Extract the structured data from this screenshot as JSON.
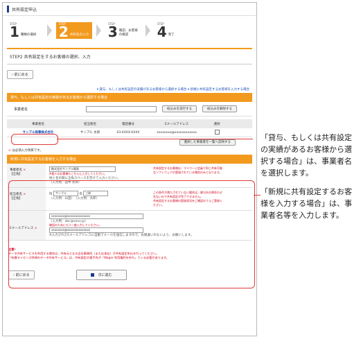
{
  "header": {
    "title": "共有設定申込"
  },
  "steps": [
    {
      "label": "STEP",
      "num": "1",
      "text": "種類の選択"
    },
    {
      "label": "STEP",
      "num": "2",
      "text": "共有先の入力"
    },
    {
      "label": "STEP",
      "num": "3",
      "text": "確認、お客様の確認"
    },
    {
      "label": "STEP",
      "num": "4",
      "text": "完了"
    }
  ],
  "step2": {
    "title": "STEP2 共有設定をするお客様の選択、入力"
  },
  "nav": {
    "back_label": "‹ 前に戻る",
    "link1": "▾ 貸与、もしくは共有設定の実績があるお客様から選択する場合",
    "link2": "▾ 新規に共有設定するお客様を入力する場合"
  },
  "section1": {
    "heading": "貸与、もしくは共有設定の実績があるお客様から選択する場合",
    "search_label": "事業者名",
    "filter_btn": "絞込みを実行する",
    "clear_btn": "絞込みを解除する",
    "columns": [
      "事業者名",
      "担当者名",
      "電話番号",
      "Eメールアドレス",
      "選択"
    ],
    "rows": [
      {
        "company": "サンプル商事株式会社",
        "contact": "サンプル 太郎",
        "phone": "03-XXXX-XXXX",
        "email": "xxxxxxxx@xxxxxxxxxxxx"
      }
    ],
    "apply_btn": "選択した事業者を一覧へ反映する"
  },
  "required_note": {
    "mark": "×",
    "text": "は必須入力項目です。"
  },
  "section2": {
    "heading": "新規に共有設定するお客様を入力する場合",
    "company_label": "事業者名",
    "company_sub": "【全角】",
    "company_value": "株式会社サンプル貿易",
    "company_hint1": "※個人のお客様もこちらに入力してください。",
    "company_hint2": "姓と名の間に全角スペースを空けて入力ください。",
    "company_hint3": "（入力例：田中 太郎）",
    "contact_label": "担当者名",
    "contact_sub": "【全角】",
    "contact_sei_label": "姓",
    "contact_sei_value": "サンプル",
    "contact_mei_label": "名",
    "contact_mei_value": "三郎",
    "contact_ex": "（入力例：山田）　（入力例：太郎）",
    "email_label": "Eメールアドレス",
    "email_value": "xxxxxxxx@xxxxxxxxxxxxxx",
    "email_ex": "（入力例：abc@xxxx.jp）",
    "email_confirm_hint": "確認のためにもう一度入力してください。",
    "email_confirm_value": "xxxxxxxx@xxxxxxxxxxxxxx",
    "email_note": "※入力されたEメールアドレスに自動でメールを送信しますので、お間違いのないよう、お願いします。",
    "side_note1": "共有設定するお客様は、マイページ会員で同じ共有可能なソフトウェアの登録されている場合のみとなります。",
    "side_note2": "この条件が満たされていない場合は、貸与先の問合わせ先ないので共有設定が完了できません。",
    "side_note3": "共有設定するお客様の登録状況をご確認のうえご登録ください。"
  },
  "warning": {
    "title": "注意！",
    "line1": "データ共有サービスを利用する場合は、共有元となる会計事務所（または本店）が共有設定申込を行ってください。",
    "line2": "「有償ライセンス特典のデータ共有サービス」は、共有設定の相手先が「Wagar 利用権利を持ち」ている必要があります。"
  },
  "footer": {
    "back_label": "‹ 前に戻る",
    "next_label": "次に進む"
  },
  "annotations": {
    "a1": "「貸与、もしくは共有設定の実績があるお客様から選択する場合」は、事業者名を選択します。",
    "a2": "「新規に共有設定するお客様を入力する場合」は、事業者名等を入力します。"
  },
  "colors": {
    "accent": "#f29a1e",
    "callout": "#e03a3a",
    "link": "#1a4fb5"
  }
}
